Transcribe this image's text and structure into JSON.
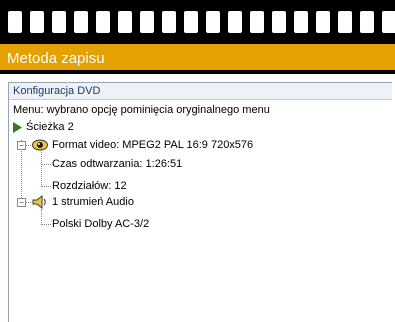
{
  "window": {
    "title": "Metoda zapisu"
  },
  "panel": {
    "header": "Konfiguracja DVD",
    "menu_line": "Menu: wybrano opcję pominięcia oryginalnego menu",
    "track": {
      "label": "Ścieżka 2",
      "icon": "play-arrow-icon",
      "video": {
        "label": "Format video: MPEG2 PAL 16:9 720x576",
        "icon": "eye-icon",
        "children": [
          "Czas odtwarzania: 1:26:51",
          "Rozdziałów: 12"
        ]
      },
      "audio": {
        "label": "1 strumień Audio",
        "icon": "speaker-icon",
        "children": [
          "Polski Dolby AC-3/2"
        ]
      }
    }
  },
  "colors": {
    "title_bar": "#e5a100",
    "film_strip": "#000000",
    "play_arrow": "#2e7d1a"
  }
}
